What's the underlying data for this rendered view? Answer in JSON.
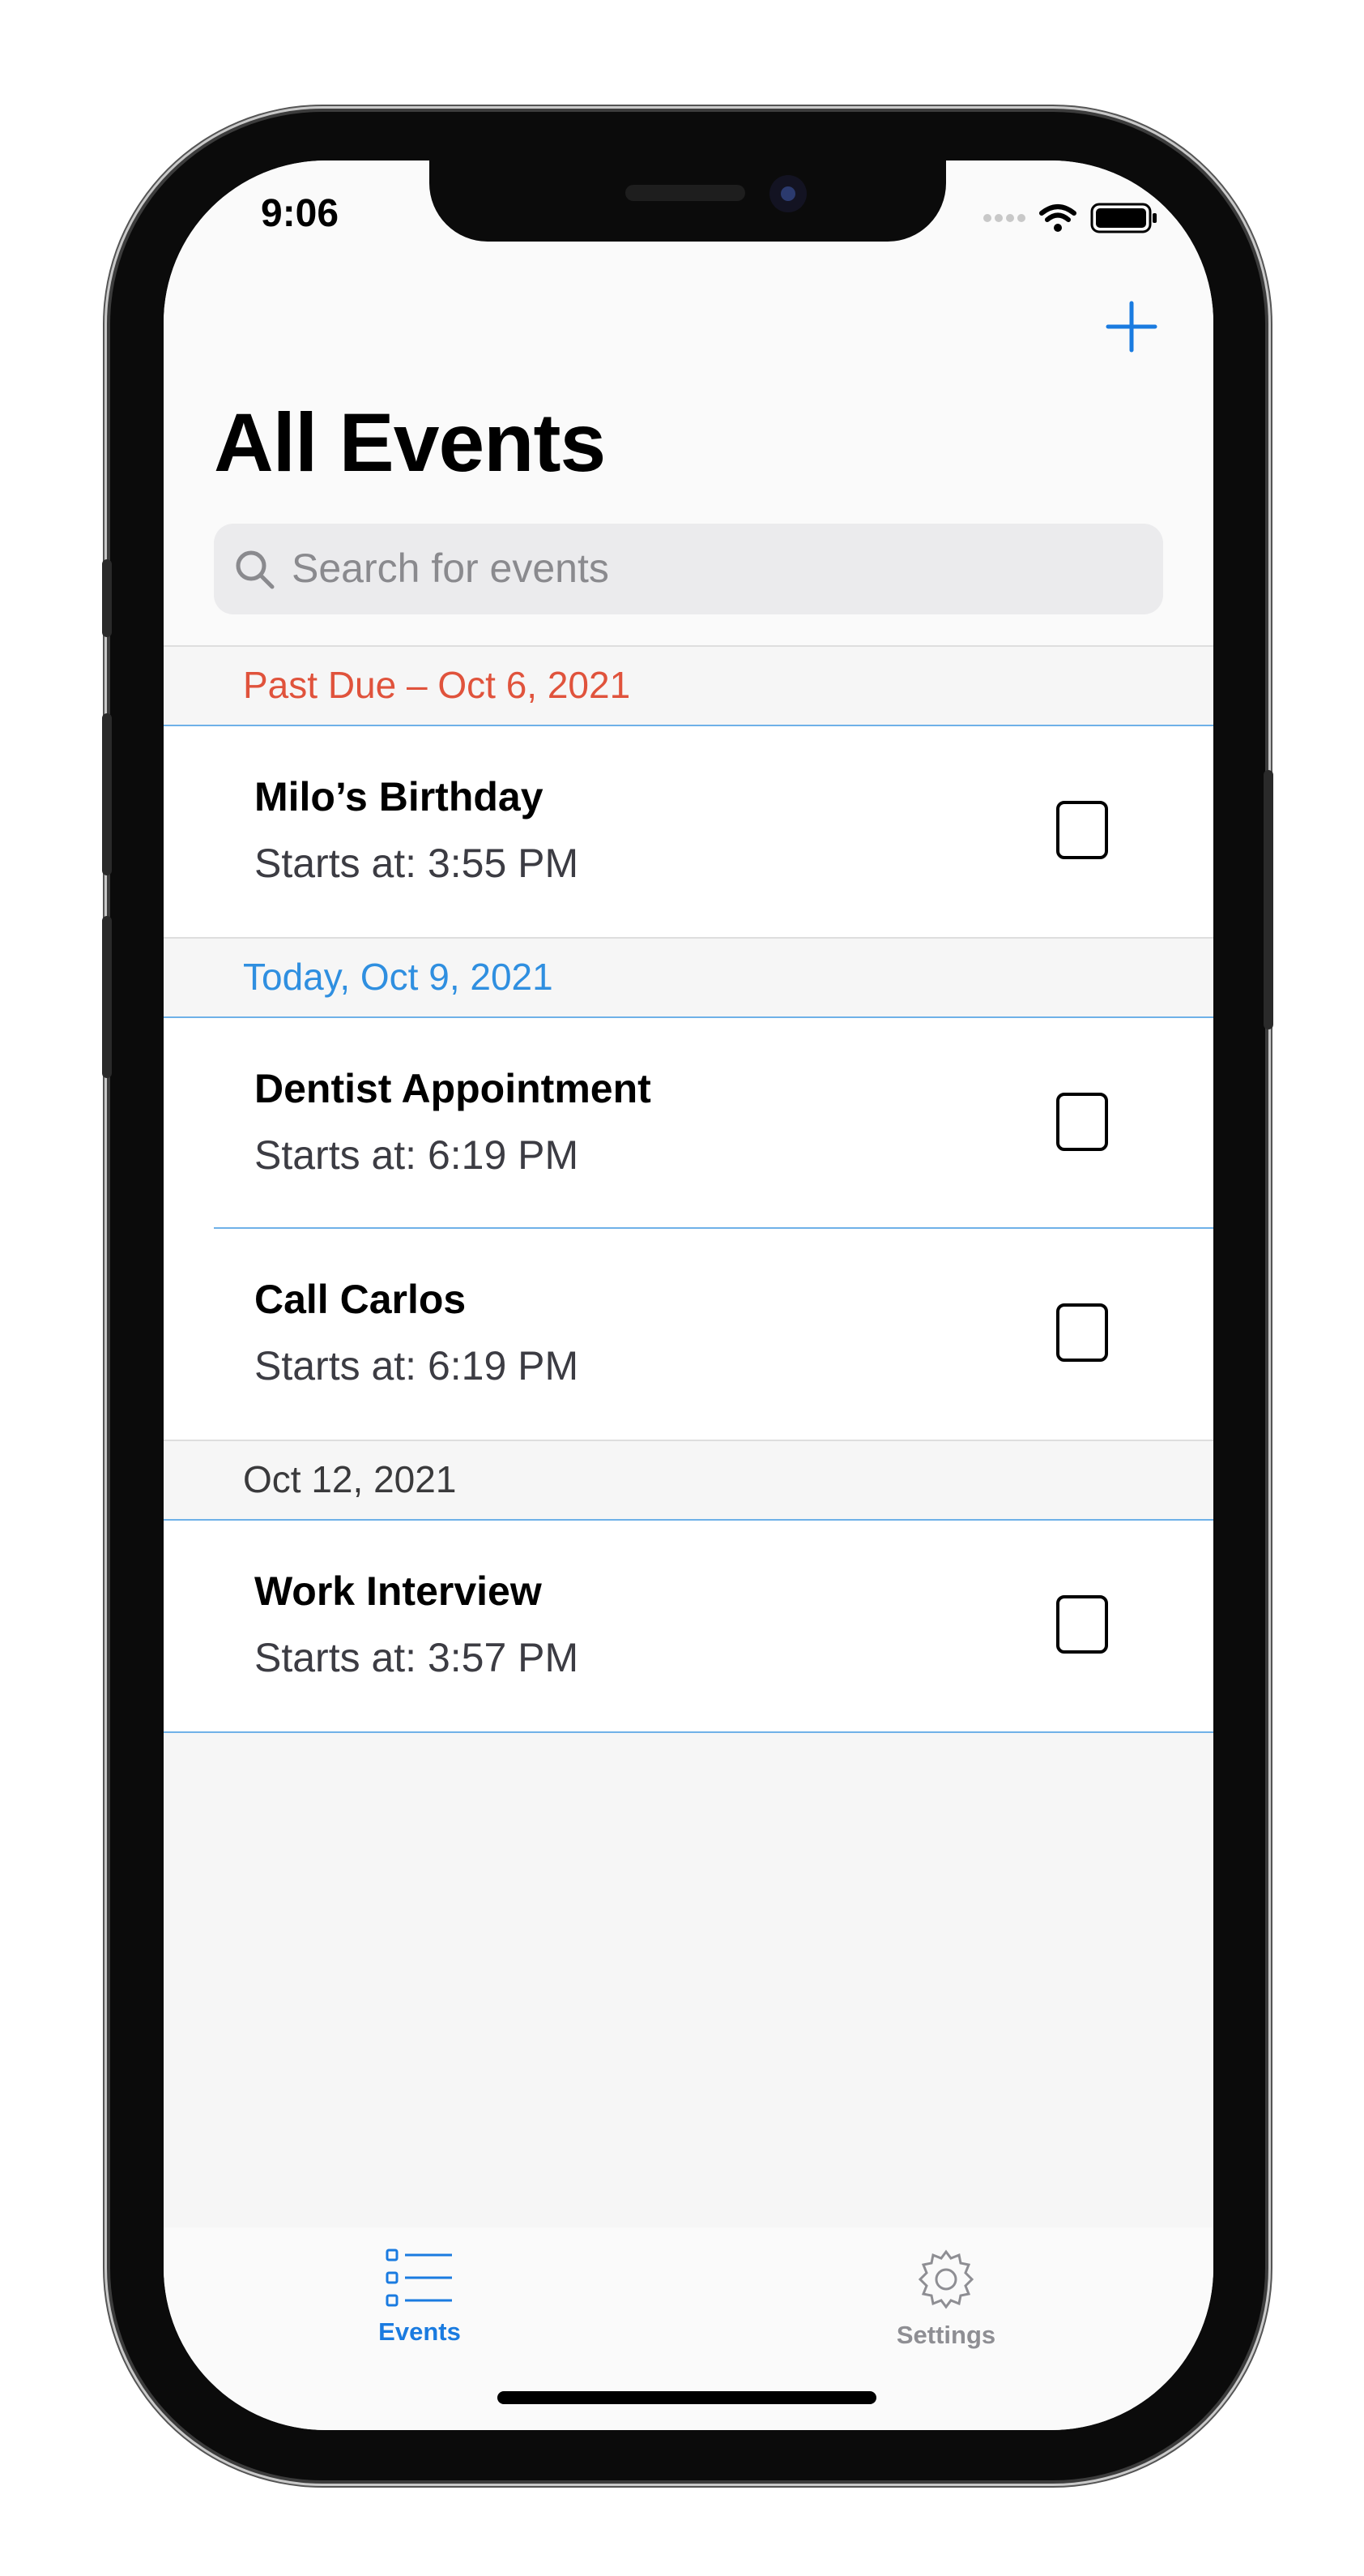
{
  "status": {
    "time": "9:06"
  },
  "nav": {
    "title": "All Events"
  },
  "search": {
    "placeholder": "Search for events"
  },
  "sections": [
    {
      "header": "Past Due – Oct 6, 2021",
      "color": "#e0533c",
      "events": [
        {
          "title": "Milo’s Birthday",
          "time": "Starts at: 3:55 PM"
        }
      ]
    },
    {
      "header": "Today, Oct 9, 2021",
      "color": "#2f8fe0",
      "events": [
        {
          "title": "Dentist Appointment",
          "time": "Starts at: 6:19 PM"
        },
        {
          "title": "Call Carlos",
          "time": "Starts at: 6:19 PM"
        }
      ]
    },
    {
      "header": "Oct 12, 2021",
      "color": "#3a3a3c",
      "events": [
        {
          "title": "Work Interview",
          "time": "Starts at: 3:57 PM"
        }
      ]
    }
  ],
  "tabs": [
    {
      "label": "Events",
      "icon": "list-icon",
      "active": true,
      "color": "#1a7be0"
    },
    {
      "label": "Settings",
      "icon": "gear-icon",
      "active": false,
      "color": "#8e8e93"
    }
  ],
  "colors": {
    "accent": "#1a7be0",
    "separator": "#6fb1e8"
  }
}
